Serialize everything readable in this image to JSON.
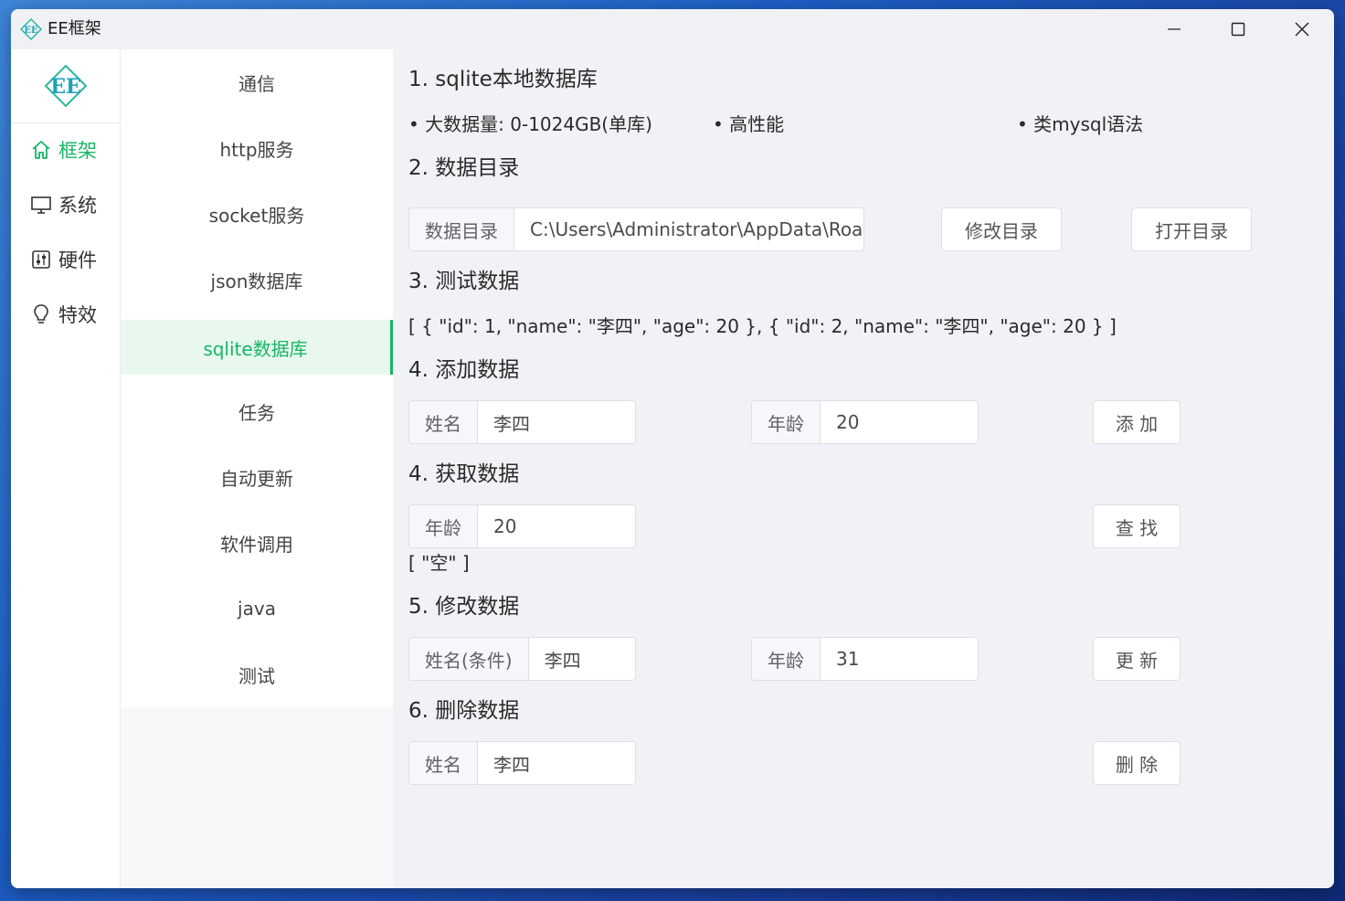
{
  "window": {
    "title": "EE框架"
  },
  "rail": {
    "items": [
      {
        "label": "框架",
        "icon": "home-icon"
      },
      {
        "label": "系统",
        "icon": "monitor-icon"
      },
      {
        "label": "硬件",
        "icon": "sliders-icon"
      },
      {
        "label": "特效",
        "icon": "bulb-icon"
      }
    ]
  },
  "submenu": {
    "items": [
      "通信",
      "http服务",
      "socket服务",
      "json数据库",
      "sqlite数据库",
      "任务",
      "自动更新",
      "软件调用",
      "java",
      "测试"
    ],
    "active": "sqlite数据库"
  },
  "sections": {
    "s1": {
      "title": "1. sqlite本地数据库",
      "features": [
        "• 大数据量: 0-1024GB(单库)",
        "• 高性能",
        "• 类mysql语法"
      ]
    },
    "s2": {
      "title": "2. 数据目录",
      "dir_label": "数据目录",
      "dir_value": "C:\\Users\\Administrator\\AppData\\Roa",
      "modify_btn": "修改目录",
      "open_btn": "打开目录"
    },
    "s3": {
      "title": "3. 测试数据",
      "json": "[ { \"id\": 1, \"name\": \"李四\", \"age\": 20 }, { \"id\": 2, \"name\": \"李四\", \"age\": 20 } ]"
    },
    "s4add": {
      "title": "4. 添加数据",
      "name_label": "姓名",
      "name_value": "李四",
      "age_label": "年龄",
      "age_value": "20",
      "btn": "添 加"
    },
    "s4get": {
      "title": "4. 获取数据",
      "age_label": "年龄",
      "age_value": "20",
      "btn": "查 找",
      "result": "[ \"空\" ]"
    },
    "s5": {
      "title": "5. 修改数据",
      "name_label": "姓名(条件)",
      "name_value": "李四",
      "age_label": "年龄",
      "age_value": "31",
      "btn": "更 新"
    },
    "s6": {
      "title": "6. 删除数据",
      "name_label": "姓名",
      "name_value": "李四",
      "btn": "删 除"
    }
  },
  "colors": {
    "accent": "#18b566",
    "active_bg": "#e8f8ef"
  }
}
